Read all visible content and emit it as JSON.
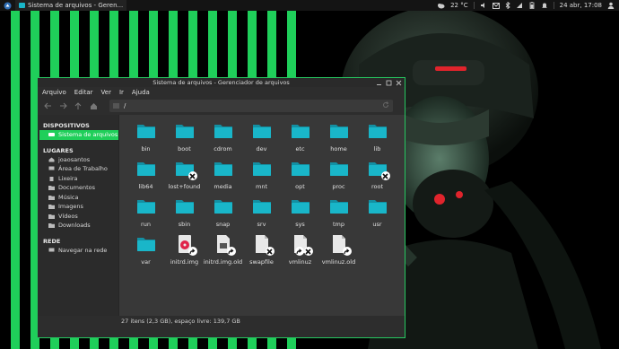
{
  "panel": {
    "task_title": "Sistema de arquivos - Geren...",
    "weather": "22 °C",
    "clock": "24 abr, 17:08"
  },
  "window": {
    "title": "Sistema de arquivos - Gerenciador de arquivos",
    "menu": [
      "Arquivo",
      "Editar",
      "Ver",
      "Ir",
      "Ajuda"
    ],
    "location": "/",
    "status": "27 itens (2,3 GB), espaço livre: 139,7 GB"
  },
  "sidebar": {
    "devices_heading": "DISPOSITIVOS",
    "devices": [
      {
        "label": "Sistema de arquivos",
        "icon": "drive-icon"
      }
    ],
    "places_heading": "LUGARES",
    "places": [
      {
        "label": "joaosantos",
        "icon": "home-icon"
      },
      {
        "label": "Área de Trabalho",
        "icon": "desktop-icon"
      },
      {
        "label": "Lixeira",
        "icon": "trash-icon"
      },
      {
        "label": "Documentos",
        "icon": "documents-icon"
      },
      {
        "label": "Música",
        "icon": "music-icon"
      },
      {
        "label": "Imagens",
        "icon": "images-icon"
      },
      {
        "label": "Vídeos",
        "icon": "videos-icon"
      },
      {
        "label": "Downloads",
        "icon": "downloads-icon"
      }
    ],
    "network_heading": "REDE",
    "network": [
      {
        "label": "Navegar na rede",
        "icon": "network-icon"
      }
    ]
  },
  "files": [
    {
      "name": "bin",
      "type": "folder"
    },
    {
      "name": "boot",
      "type": "folder"
    },
    {
      "name": "cdrom",
      "type": "folder"
    },
    {
      "name": "dev",
      "type": "folder"
    },
    {
      "name": "etc",
      "type": "folder"
    },
    {
      "name": "home",
      "type": "folder"
    },
    {
      "name": "lib",
      "type": "folder"
    },
    {
      "name": "lib64",
      "type": "folder"
    },
    {
      "name": "lost+found",
      "type": "folder",
      "badge": "locked"
    },
    {
      "name": "media",
      "type": "folder"
    },
    {
      "name": "mnt",
      "type": "folder"
    },
    {
      "name": "opt",
      "type": "folder"
    },
    {
      "name": "proc",
      "type": "folder"
    },
    {
      "name": "root",
      "type": "folder",
      "badge": "locked"
    },
    {
      "name": "run",
      "type": "folder"
    },
    {
      "name": "sbin",
      "type": "folder"
    },
    {
      "name": "snap",
      "type": "folder"
    },
    {
      "name": "srv",
      "type": "folder"
    },
    {
      "name": "sys",
      "type": "folder"
    },
    {
      "name": "tmp",
      "type": "folder"
    },
    {
      "name": "usr",
      "type": "folder"
    },
    {
      "name": "var",
      "type": "folder"
    },
    {
      "name": "initrd.img",
      "type": "disk-image",
      "badge": "link"
    },
    {
      "name": "initrd.img.old",
      "type": "image-doc",
      "badge": "link"
    },
    {
      "name": "swapfile",
      "type": "doc",
      "badge": "locked"
    },
    {
      "name": "vmlinuz",
      "type": "doc",
      "badge": "link-locked"
    },
    {
      "name": "vmlinuz.old",
      "type": "doc",
      "badge": "link"
    }
  ],
  "colors": {
    "accent": "#1fcf5a",
    "folder": "#19b6c9",
    "folder_dark": "#1390a3"
  }
}
